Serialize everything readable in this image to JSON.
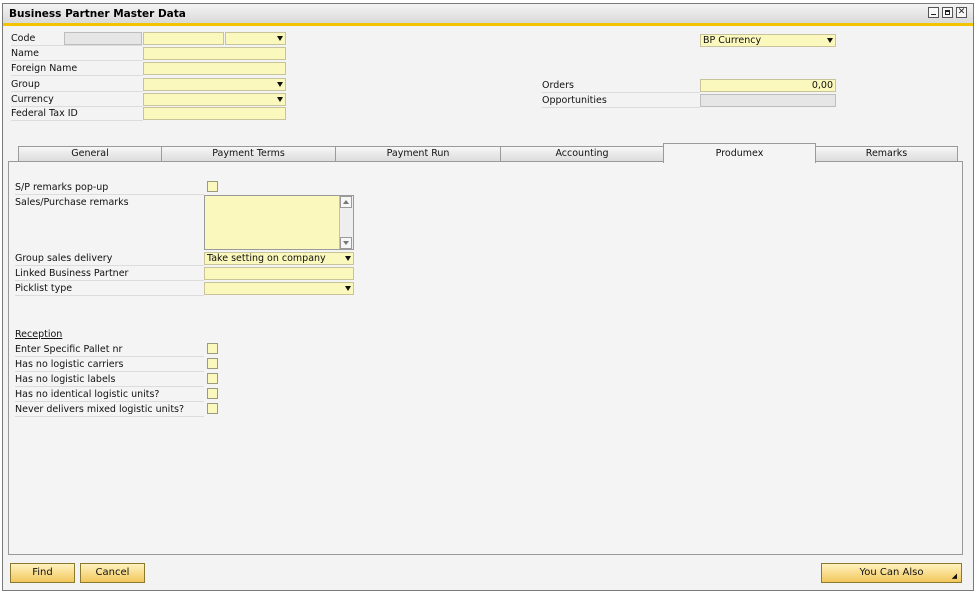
{
  "window": {
    "title": "Business Partner Master Data"
  },
  "header": {
    "code_label": "Code",
    "name_label": "Name",
    "foreign_name_label": "Foreign Name",
    "group_label": "Group",
    "currency_label": "Currency",
    "federal_tax_label": "Federal Tax ID",
    "bp_currency": "BP Currency",
    "orders_label": "Orders",
    "orders_value": "0,00",
    "opportunities_label": "Opportunities"
  },
  "tabs": [
    {
      "label": "General"
    },
    {
      "label": "Payment Terms"
    },
    {
      "label": "Payment Run"
    },
    {
      "label": "Accounting"
    },
    {
      "label": "Produmex"
    },
    {
      "label": "Remarks"
    }
  ],
  "active_tab": "Produmex",
  "produmex": {
    "sp_popup_label": "S/P remarks pop-up",
    "sp_remarks_label": "Sales/Purchase remarks",
    "group_sales_delivery_label": "Group sales delivery",
    "group_sales_delivery_value": "Take setting on company",
    "linked_bp_label": "Linked Business Partner",
    "picklist_type_label": "Picklist type",
    "reception_heading": "Reception",
    "reception_items": [
      {
        "label": "Enter Specific Pallet nr"
      },
      {
        "label": "Has no logistic carriers"
      },
      {
        "label": "Has no logistic labels"
      },
      {
        "label": "Has no identical logistic units?"
      },
      {
        "label": "Never delivers mixed logistic units?"
      }
    ]
  },
  "footer": {
    "find_label": "Find",
    "cancel_label": "Cancel",
    "you_can_also_label": "You Can Also"
  },
  "colors": {
    "accent": "#f3c200",
    "field_bg": "#fbf8bd"
  }
}
